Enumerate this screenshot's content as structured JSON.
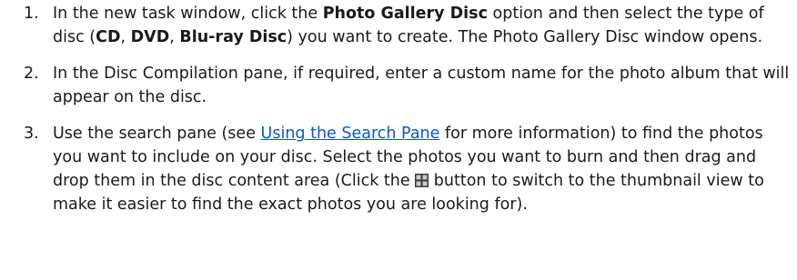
{
  "steps": [
    {
      "number": "1.",
      "text_1": "In the new task window, click the ",
      "bold_1": "Photo Gallery Disc",
      "text_2": " option and then select the type of disc (",
      "bold_2": "CD",
      "text_3": ", ",
      "bold_3": "DVD",
      "text_4": ", ",
      "bold_4": "Blu-ray Disc",
      "text_5": ") you want to create. The Photo Gallery Disc window opens."
    },
    {
      "number": "2.",
      "text_1": "In the Disc Compilation pane, if required, enter a custom name for the photo album that will appear on the disc."
    },
    {
      "number": "3.",
      "text_1": "Use the search pane (see ",
      "link_1": "Using the Search Pane",
      "text_2": " for more information) to find the photos you want to include on your disc. Select the photos you want to burn and then drag and drop them in the disc content area (Click the ",
      "icon_1": "thumbnail-view-grid-icon",
      "text_3": " button to switch to the thumbnail view to make it easier to find the exact photos you are looking for)."
    }
  ],
  "colors": {
    "text": "#1a1a1a",
    "link": "#0b57d0",
    "icon_dark": "#3a3a3a",
    "icon_light": "#c8c8c8"
  }
}
